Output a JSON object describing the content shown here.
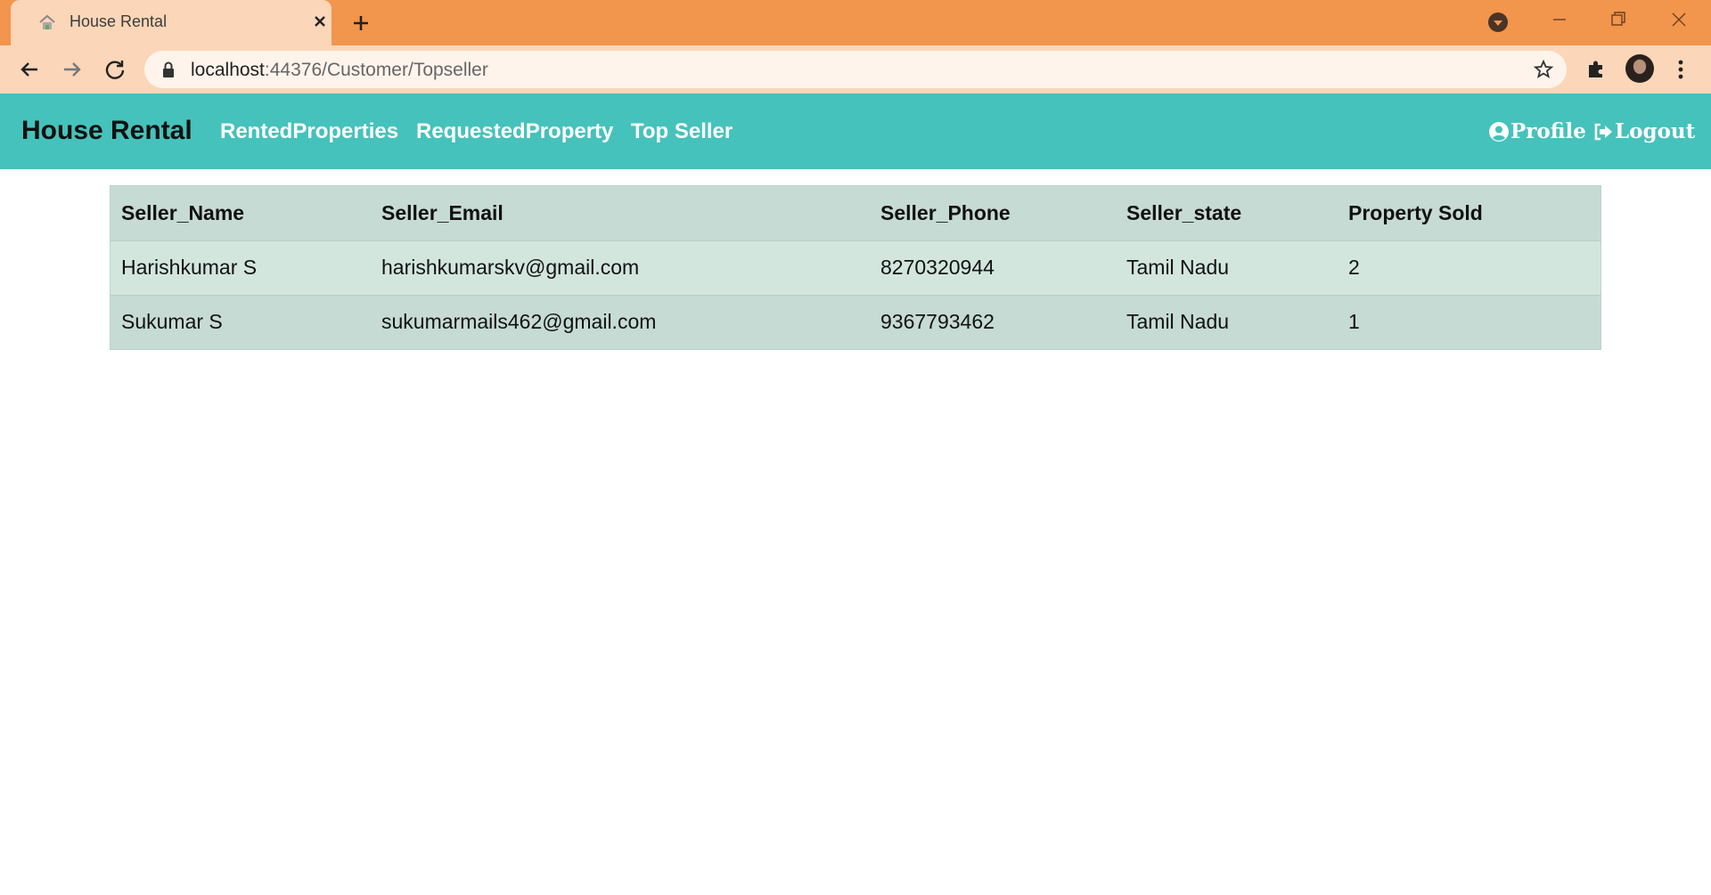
{
  "browser": {
    "tab_title": "House Rental",
    "url_host": "localhost",
    "url_rest": ":44376/Customer/Topseller"
  },
  "navbar": {
    "brand": "House Rental",
    "links": [
      "RentedProperties",
      "RequestedProperty",
      "Top Seller"
    ],
    "profile_label": "Profile",
    "logout_label": "Logout"
  },
  "table": {
    "headers": [
      "Seller_Name",
      "Seller_Email",
      "Seller_Phone",
      "Seller_state",
      "Property Sold"
    ],
    "rows": [
      [
        "Harishkumar S",
        "harishkumarskv@gmail.com",
        "8270320944",
        "Tamil Nadu",
        "2"
      ],
      [
        "Sukumar S",
        "sukumarmails462@gmail.com",
        "9367793462",
        "Tamil Nadu",
        "1"
      ]
    ]
  },
  "colors": {
    "tabstrip": "#f2954d",
    "toolbar": "#fbd6b8",
    "navbar": "#45c2bb",
    "table_header": "#c6dbd3",
    "table_row_odd": "#d2e6de"
  }
}
